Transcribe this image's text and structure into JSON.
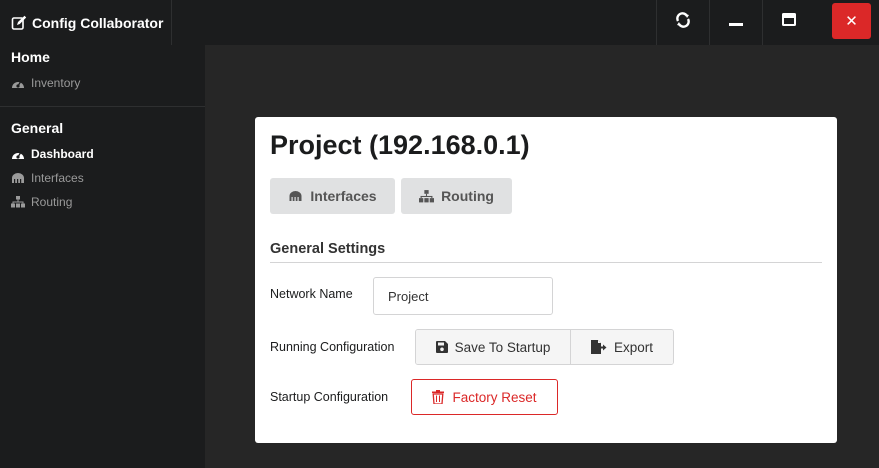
{
  "app": {
    "title": "Config Collaborator",
    "close_label": "✕"
  },
  "sidebar": {
    "sections": [
      {
        "header": "Home",
        "items": [
          {
            "label": "Inventory",
            "icon": "dashboard-icon",
            "active": false
          }
        ]
      },
      {
        "header": "General",
        "items": [
          {
            "label": "Dashboard",
            "icon": "dashboard-icon",
            "active": true
          },
          {
            "label": "Interfaces",
            "icon": "network-port-icon",
            "active": false
          },
          {
            "label": "Routing",
            "icon": "sitemap-icon",
            "active": false
          }
        ]
      }
    ]
  },
  "main": {
    "title": "Project (192.168.0.1)",
    "tabs": [
      {
        "label": "Interfaces",
        "icon": "network-port-icon"
      },
      {
        "label": "Routing",
        "icon": "sitemap-icon"
      }
    ],
    "section_title": "General Settings",
    "network_name_label": "Network Name",
    "network_name_value": "Project",
    "running_config_label": "Running Configuration",
    "save_to_startup_label": "Save To Startup",
    "export_label": "Export",
    "startup_config_label": "Startup Configuration",
    "factory_reset_label": "Factory Reset"
  },
  "colors": {
    "background": "#1b1c1d",
    "main_background": "#262626",
    "danger": "#db2828",
    "button_grey": "#e0e1e2"
  }
}
